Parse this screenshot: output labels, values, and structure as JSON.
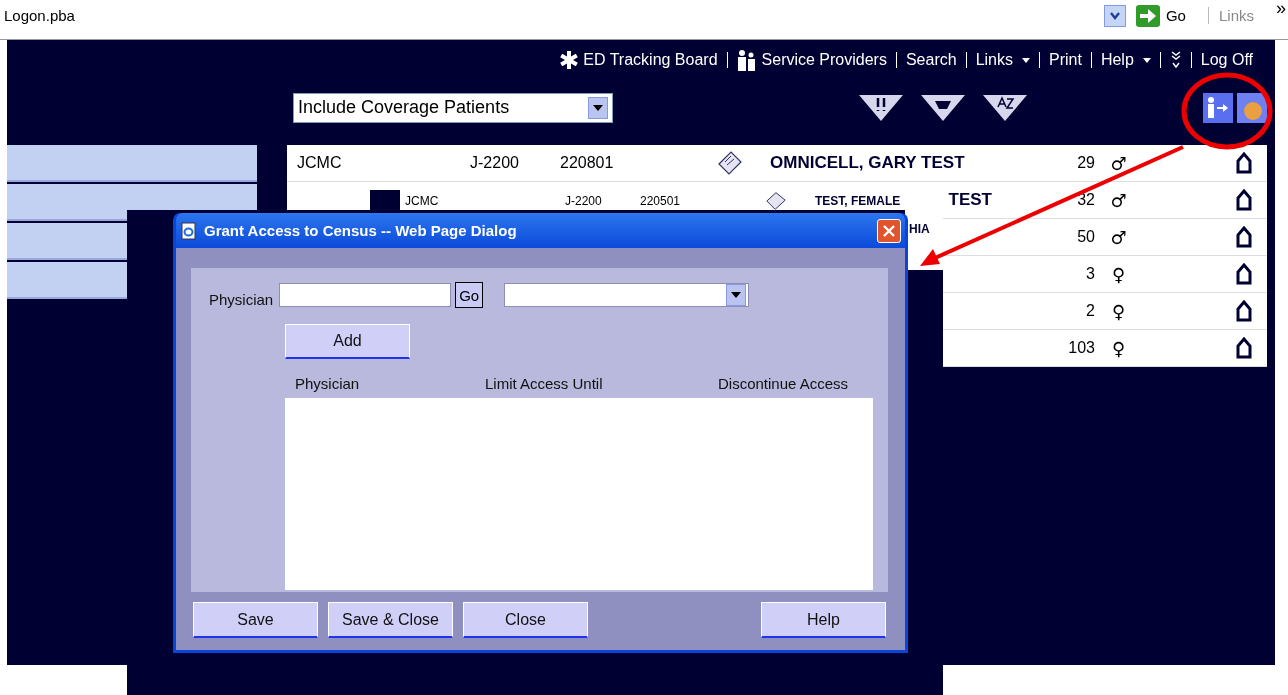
{
  "address_bar": {
    "text": "Logon.pba",
    "go_button": "Go",
    "links": "Links",
    "more": "»"
  },
  "nav": [
    {
      "label": "ED Tracking Board",
      "dropdown": false
    },
    {
      "label": "Service Providers",
      "dropdown": false
    },
    {
      "label": "Search",
      "dropdown": false
    },
    {
      "label": "Links",
      "dropdown": true
    },
    {
      "label": "Print",
      "dropdown": false
    },
    {
      "label": "Help",
      "dropdown": true
    },
    {
      "label": "Log Off",
      "dropdown": false
    }
  ],
  "filter": {
    "value": "Include Coverage Patients"
  },
  "table": {
    "rows": [
      {
        "kind": "full",
        "site": "JCMC",
        "unit": "J-2200",
        "bed": "220801",
        "note": true,
        "name": "OMNICELL, GARY TEST",
        "age": "29",
        "sex": "♂"
      },
      {
        "kind": "covered",
        "name": "TEST",
        "age": "32",
        "sex": "♂"
      },
      {
        "kind": "covered",
        "age": "50",
        "sex": "♂"
      },
      {
        "kind": "covered",
        "age": "3",
        "sex": "♀"
      },
      {
        "kind": "covered",
        "age": "2",
        "sex": "♀"
      },
      {
        "kind": "covered",
        "age": "103",
        "sex": "♀"
      }
    ]
  },
  "overlay_row": {
    "site": "JCMC",
    "unit": "J-2200",
    "bed": "220501",
    "name": "TEST, FEMALE",
    "name_2": "HIA"
  },
  "dialog": {
    "title": "Grant Access to Census -- Web Page Dialog",
    "physician_label": "Physician",
    "go_button": "Go",
    "add_button": "Add",
    "columns": [
      "Physician",
      "Limit Access Until",
      "Discontinue Access"
    ],
    "buttons": [
      {
        "label": "Save",
        "kind": "left"
      },
      {
        "label": "Save & Close",
        "kind": "left"
      },
      {
        "label": "Close",
        "kind": "left"
      },
      {
        "label": "Help",
        "kind": "right"
      }
    ]
  }
}
